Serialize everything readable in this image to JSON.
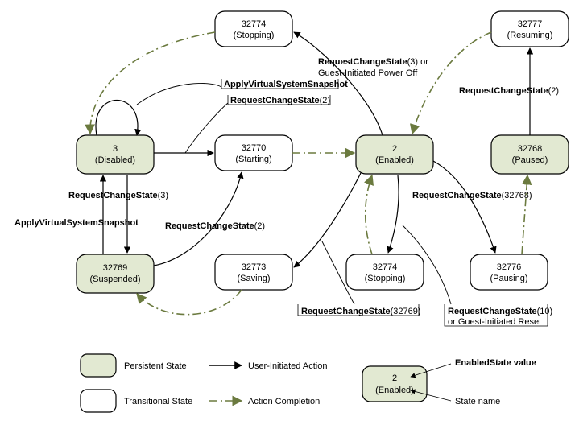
{
  "chart_data": {
    "type": "state-diagram",
    "title": "",
    "states": [
      {
        "id": "disabled",
        "value": 3,
        "name": "Disabled",
        "kind": "persistent"
      },
      {
        "id": "suspended",
        "value": 32769,
        "name": "Suspended",
        "kind": "persistent"
      },
      {
        "id": "starting",
        "value": 32770,
        "name": "Starting",
        "kind": "transitional"
      },
      {
        "id": "saving",
        "value": 32773,
        "name": "Saving",
        "kind": "transitional"
      },
      {
        "id": "stopping_top",
        "value": 32774,
        "name": "Stopping",
        "kind": "transitional"
      },
      {
        "id": "stopping_bottom",
        "value": 32774,
        "name": "Stopping",
        "kind": "transitional"
      },
      {
        "id": "enabled",
        "value": 2,
        "name": "Enabled",
        "kind": "persistent"
      },
      {
        "id": "resuming",
        "value": 32777,
        "name": "Resuming",
        "kind": "transitional"
      },
      {
        "id": "paused",
        "value": 32768,
        "name": "Paused",
        "kind": "persistent"
      },
      {
        "id": "pausing",
        "value": 32776,
        "name": "Pausing",
        "kind": "transitional"
      }
    ],
    "transitions": [
      {
        "from": "disabled",
        "to": "disabled",
        "label": "ApplyVirtualSystemSnapshot",
        "user": true
      },
      {
        "from": "disabled",
        "to": "starting",
        "label": "RequestChangeState(2)",
        "user": true
      },
      {
        "from": "disabled",
        "to": "suspended",
        "label": "ApplyVirtualSystemSnapshot",
        "user": true
      },
      {
        "from": "suspended",
        "to": "disabled",
        "label": "RequestChangeState(3)",
        "user": true
      },
      {
        "from": "suspended",
        "to": "starting",
        "label": "RequestChangeState(2)",
        "user": true
      },
      {
        "from": "starting",
        "to": "enabled",
        "label": "",
        "user": false
      },
      {
        "from": "enabled",
        "to": "stopping_top",
        "label": "RequestChangeState(3) or Guest-Initiated Power Off",
        "user": true
      },
      {
        "from": "stopping_top",
        "to": "disabled",
        "label": "",
        "user": false
      },
      {
        "from": "enabled",
        "to": "stopping_bottom",
        "label": "RequestChangeState(10) or Guest-Initiated Reset",
        "user": true
      },
      {
        "from": "stopping_bottom",
        "to": "enabled",
        "label": "",
        "user": false
      },
      {
        "from": "enabled",
        "to": "saving",
        "label": "RequestChangeState(32769)",
        "user": true
      },
      {
        "from": "saving",
        "to": "suspended",
        "label": "",
        "user": false
      },
      {
        "from": "enabled",
        "to": "pausing",
        "label": "RequestChangeState(32768)",
        "user": true
      },
      {
        "from": "pausing",
        "to": "paused",
        "label": "",
        "user": false
      },
      {
        "from": "paused",
        "to": "resuming",
        "label": "RequestChangeState(2)",
        "user": true
      },
      {
        "from": "resuming",
        "to": "enabled",
        "label": "",
        "user": false
      }
    ],
    "legend": {
      "persistent": "Persistent State",
      "transitional": "Transitional State",
      "user_action": "User-Initiated Action",
      "action_completion": "Action Completion",
      "enabled_state_value": "EnabledState value",
      "state_name": "State name",
      "sample_value": "2",
      "sample_name": "(Enabled)"
    }
  },
  "labels": {
    "apply_snapshot": "ApplyVirtualSystemSnapshot",
    "rcs2": "RequestChangeState",
    "rcs2_arg": "(2)",
    "rcs3": "RequestChangeState",
    "rcs3_arg": "(3)",
    "rcs3_or": "(3) or",
    "guest_off": "Guest-Initiated Power Off",
    "rcs10_arg": "(10)",
    "guest_reset": "or Guest-Initiated Reset",
    "rcs32768_arg": "(32768)",
    "rcs32769_arg": "(32769)"
  }
}
